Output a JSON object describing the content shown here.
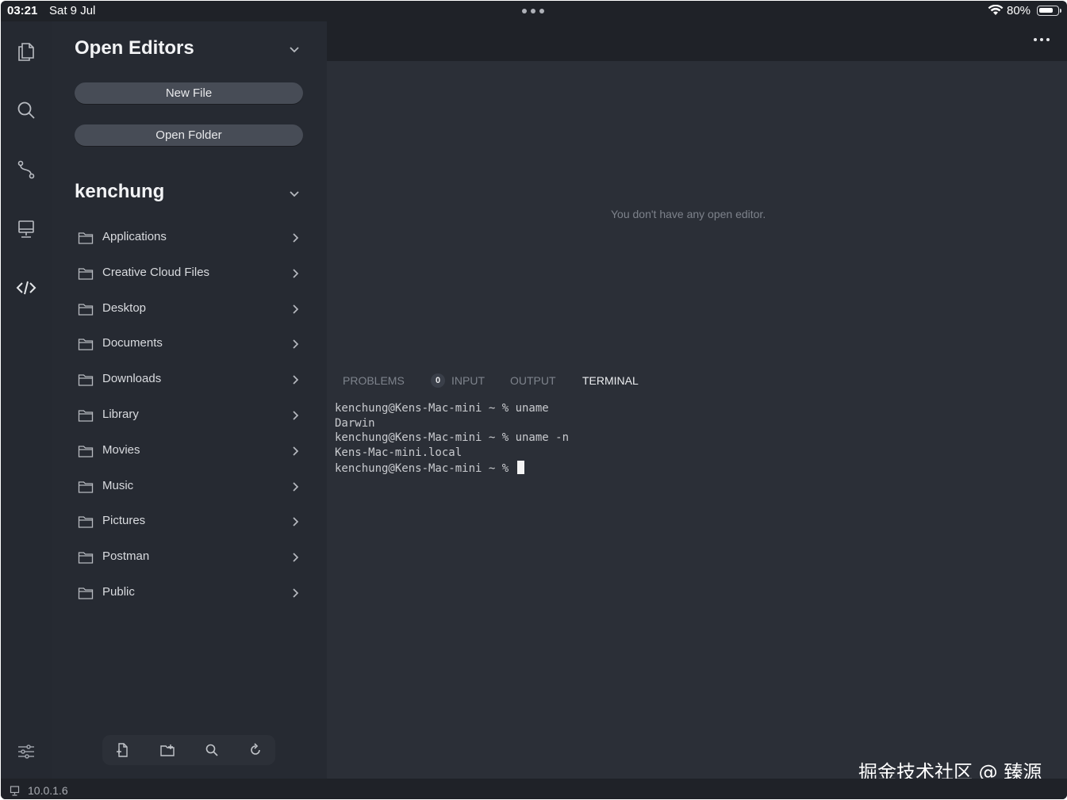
{
  "status_bar": {
    "time": "03:21",
    "date": "Sat 9 Jul",
    "battery": "80%",
    "battery_level": 0.8
  },
  "sidebar": {
    "open_editors_title": "Open Editors",
    "new_file_label": "New File",
    "open_folder_label": "Open Folder",
    "folder_name": "kenchung",
    "items": [
      {
        "label": "Applications"
      },
      {
        "label": "Creative Cloud Files"
      },
      {
        "label": "Desktop"
      },
      {
        "label": "Documents"
      },
      {
        "label": "Downloads"
      },
      {
        "label": "Library"
      },
      {
        "label": "Movies"
      },
      {
        "label": "Music"
      },
      {
        "label": "Pictures"
      },
      {
        "label": "Postman"
      },
      {
        "label": "Public"
      }
    ]
  },
  "editor": {
    "empty_message": "You don't have any open editor."
  },
  "panel": {
    "tabs": {
      "problems": "PROBLEMS",
      "problems_count": "0",
      "input": "INPUT",
      "output": "OUTPUT",
      "terminal": "TERMINAL"
    },
    "active_tab": "terminal",
    "terminal_lines": {
      "l1": "kenchung@Kens-Mac-mini ~ % uname",
      "l2": "Darwin",
      "l3": "kenchung@Kens-Mac-mini ~ % uname -n",
      "l4": "Kens-Mac-mini.local",
      "l5": "kenchung@Kens-Mac-mini ~ % "
    }
  },
  "footer": {
    "host": "10.0.1.6"
  },
  "watermark": "掘金技术社区 @ 臻源",
  "colors": {
    "background": "#1f2228",
    "sidebar": "#262a32",
    "editor": "#2b2f37",
    "button": "#474c56"
  }
}
